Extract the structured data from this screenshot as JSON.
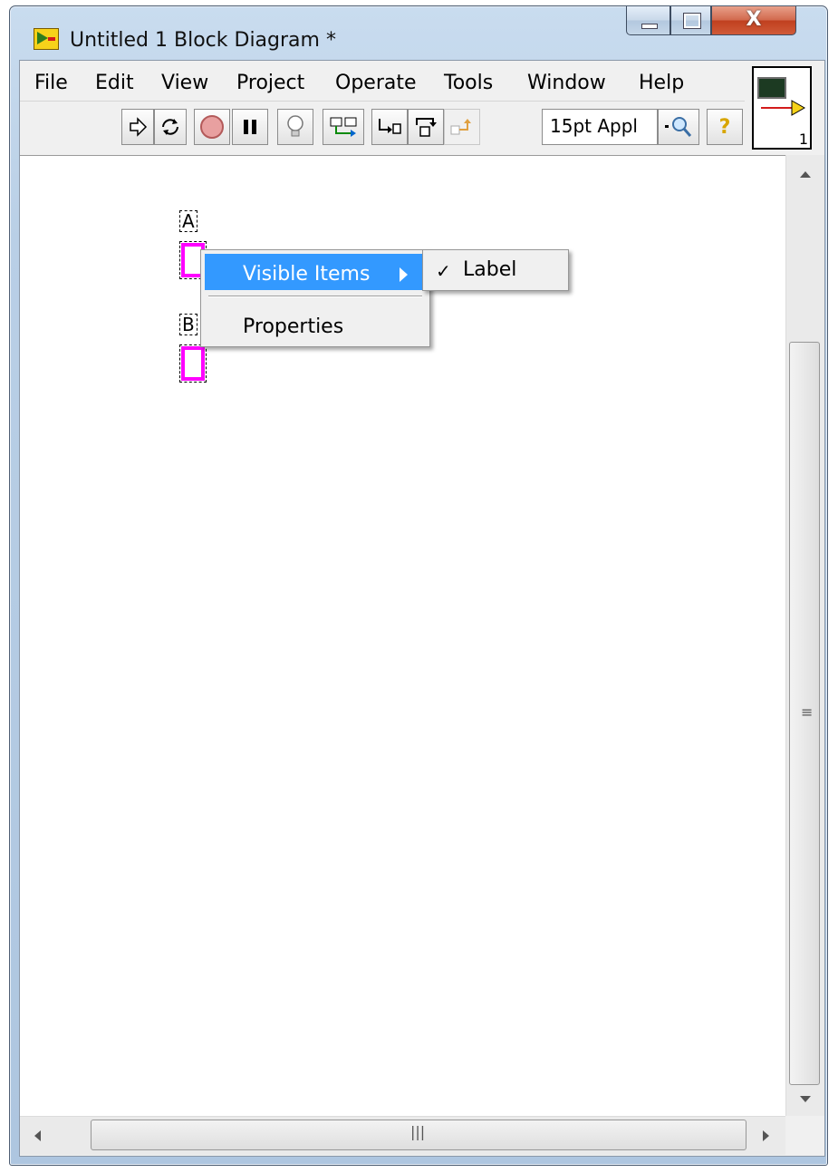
{
  "window": {
    "title": "Untitled 1 Block Diagram *",
    "close_glyph": "X"
  },
  "menubar": {
    "items": [
      "File",
      "Edit",
      "View",
      "Project",
      "Operate",
      "Tools",
      "Window",
      "Help"
    ]
  },
  "toolbar": {
    "font_select_value": "15pt Appl",
    "help_glyph": "?",
    "vi_icon_number": "1",
    "button_icons": [
      "run-arrow-icon",
      "run-continuously-icon",
      "abort-icon",
      "pause-icon",
      "highlight-execution-icon",
      "retain-wire-values-icon",
      "step-into-icon",
      "step-over-icon",
      "step-out-icon",
      "search-icon",
      "context-help-icon"
    ]
  },
  "diagram": {
    "terminals": [
      {
        "label": "A"
      },
      {
        "label": "B"
      }
    ]
  },
  "context_menu": {
    "items": [
      {
        "label": "Visible Items",
        "highlighted": true,
        "has_submenu": true
      },
      {
        "label": "Properties",
        "highlighted": false,
        "has_submenu": false
      }
    ],
    "submenu": {
      "items": [
        {
          "label": "Label",
          "checked": true,
          "check_glyph": "✓"
        }
      ]
    }
  },
  "colors": {
    "terminal_border": "#ff00ff",
    "menu_highlight": "#3399ff"
  }
}
